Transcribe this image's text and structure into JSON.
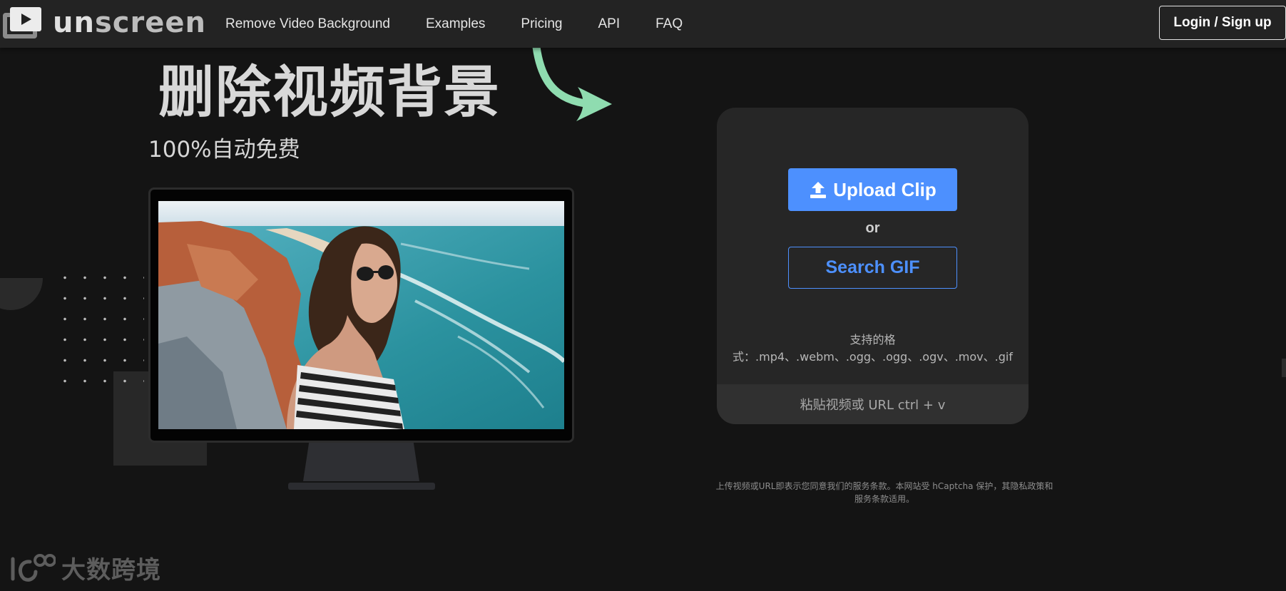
{
  "header": {
    "logo_text_a": "un",
    "logo_text_b": "screen",
    "nav": [
      "Remove Video Background",
      "Examples",
      "Pricing",
      "API",
      "FAQ"
    ],
    "login_label": "Login / Sign up"
  },
  "hero": {
    "title": "删除视频背景",
    "subtitle": "100%自动免费"
  },
  "upload": {
    "upload_label": "Upload Clip",
    "or_label": "or",
    "search_label": "Search GIF",
    "formats_line1": "支持的格",
    "formats_line2": "式：.mp4、.webm、.ogg、.ogg、.ogv、.mov、.gif",
    "paste_hint": "粘贴视频或 URL ctrl + v"
  },
  "terms_text": "上传视频或URL即表示您同意我们的服务条款。本网站受 hCaptcha 保护，其隐私政策和服务条款适用。",
  "watermark": {
    "text": "大数跨境"
  },
  "icons": {
    "upload": "upload-icon",
    "arrow": "curved-arrow-icon",
    "logo": "play-screen-icon"
  },
  "colors": {
    "accent": "#4d90fe",
    "arrow": "#8fdcb0",
    "background": "#141414",
    "header": "#232323",
    "card": "#262626"
  }
}
